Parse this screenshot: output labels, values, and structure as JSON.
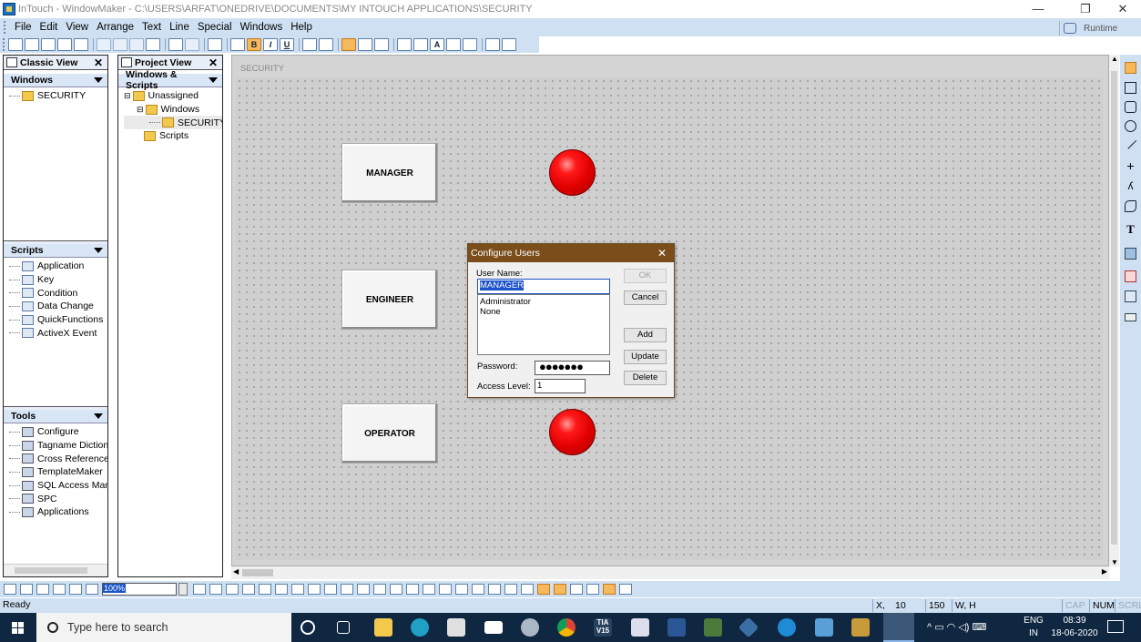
{
  "window": {
    "title": "InTouch - WindowMaker - C:\\USERS\\ARFAT\\ONEDRIVE\\DOCUMENTS\\MY INTOUCH APPLICATIONS\\SECURITY",
    "minimize": "—",
    "restore": "❐",
    "close": "✕"
  },
  "menu": {
    "items": [
      "File",
      "Edit",
      "View",
      "Arrange",
      "Text",
      "Line",
      "Special",
      "Windows",
      "Help"
    ],
    "runtime_label": "Runtime"
  },
  "toolbar": {
    "bold": "B",
    "italic": "I",
    "underline": "U",
    "text_tool": "A"
  },
  "classic_view": {
    "title": "Classic View",
    "close": "✕",
    "windows_section": "Windows",
    "windows": [
      "SECURITY"
    ],
    "scripts_section": "Scripts",
    "scripts": [
      "Application",
      "Key",
      "Condition",
      "Data Change",
      "QuickFunctions",
      "ActiveX Event"
    ],
    "tools_section": "Tools",
    "tools": [
      "Configure",
      "Tagname Dictiona",
      "Cross Reference",
      "TemplateMaker",
      "SQL Access Manag",
      "SPC",
      "Applications"
    ]
  },
  "project_view": {
    "title": "Project View",
    "close": "✕",
    "section": "Windows & Scripts",
    "unassigned": "Unassigned",
    "windows_folder": "Windows",
    "window_item": "SECURITY",
    "scripts_folder": "Scripts"
  },
  "canvas": {
    "window_title": "SECURITY",
    "buttons": [
      "MANAGER",
      "ENGINEER",
      "OPERATOR"
    ]
  },
  "dialog": {
    "title": "Configure Users",
    "close": "✕",
    "user_name_label": "User Name:",
    "user_name_value": "MANAGER",
    "users": [
      "Administrator",
      "None"
    ],
    "password_label": "Password:",
    "password_value": "●●●●●●●",
    "access_level_label": "Access Level:",
    "access_level_value": "1",
    "ok_label": "OK",
    "cancel_label": "Cancel",
    "add_label": "Add",
    "update_label": "Update",
    "delete_label": "Delete"
  },
  "bottom_toolbar": {
    "zoom_value": "100%"
  },
  "status": {
    "ready": "Ready",
    "xy_label": "X, Y",
    "x": "10",
    "y": "150",
    "wh_label": "W, H",
    "cap": "CAP",
    "num": "NUM",
    "scrl": "SCRL"
  },
  "taskbar": {
    "search_placeholder": "Type here to search",
    "lang_top": "ENG",
    "lang_bottom": "IN",
    "time": "08:39",
    "date": "18-06-2020",
    "tia_label": "TIA\nV15"
  },
  "colors": {
    "dialog_title": "#7a4d1b",
    "indicator": "#e10000",
    "chrome": "#cfe0f3",
    "taskbar": "#0f2741"
  }
}
